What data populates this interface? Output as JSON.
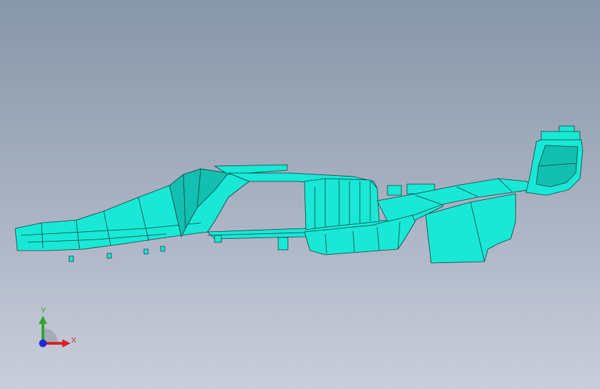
{
  "viewport": {
    "background_top": "#8797a8",
    "background_bottom": "#c9cedb"
  },
  "model": {
    "name": "cad-part-model",
    "fill_color": "#19e8d6",
    "shade_color": "#12bfb0",
    "edge_color": "#0a3d3a"
  },
  "triad": {
    "y_label": "Y",
    "x_label": "X",
    "y_color": "#2fa52f",
    "x_color": "#d42424",
    "z_color": "#1e2ad8",
    "icons": [
      "triad-y-arrow-icon",
      "triad-x-arrow-icon",
      "triad-z-dot-icon"
    ]
  }
}
